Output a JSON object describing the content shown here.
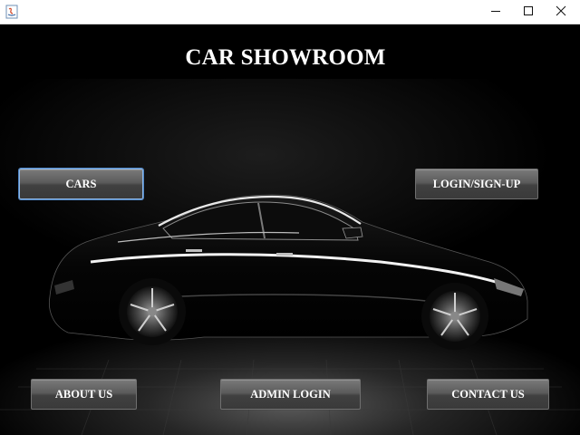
{
  "window": {
    "title": "",
    "icons": {
      "app": "java-app-icon",
      "minimize": "minimize-icon",
      "maximize": "maximize-icon",
      "close": "close-icon"
    }
  },
  "page": {
    "heading": "CAR SHOWROOM",
    "background_image": "black-sedan-car-photo"
  },
  "buttons": {
    "cars": "CARS",
    "login_signup": "LOGIN/SIGN-UP",
    "about_us": "ABOUT US",
    "admin_login": "ADMIN LOGIN",
    "contact_us": "CONTACT US"
  },
  "colors": {
    "background": "#000000",
    "heading_text": "#ffffff",
    "button_face": "#4a4a4a",
    "button_text": "#ffffff",
    "focus_ring": "#4f86c6"
  }
}
